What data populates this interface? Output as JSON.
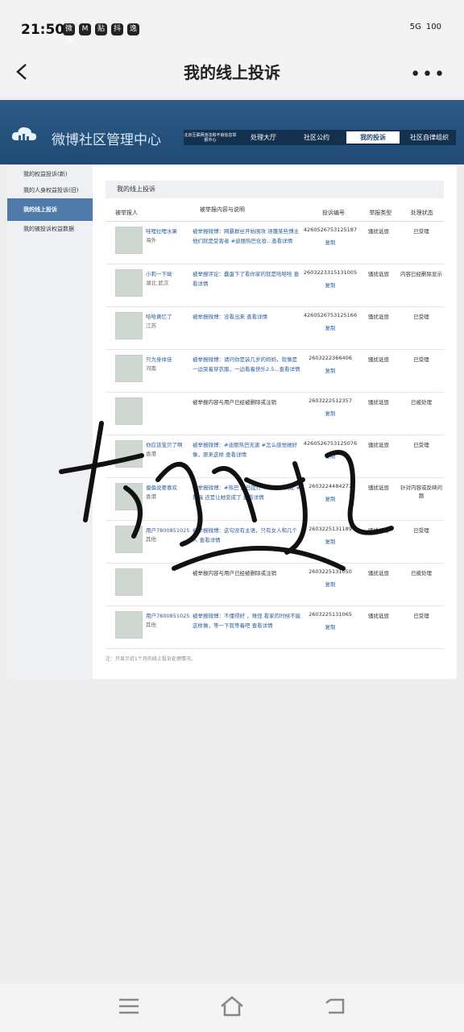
{
  "status_bar": {
    "time": "21:50",
    "apps": [
      "微博",
      "M",
      "贴",
      "抖",
      "逸"
    ],
    "network": "5G",
    "battery": "100"
  },
  "nav": {
    "title": "我的线上投诉"
  },
  "header": {
    "site_name": "微博社区管理中心",
    "nav_items": [
      "北京互联网违法和不良信息举报中心",
      "处理大厅",
      "社区公约",
      "我的投诉",
      "社区自律组织"
    ]
  },
  "sidebar": {
    "items": [
      "我的权益投诉(新)",
      "我的人身权益投诉(旧)",
      "我的线上投诉",
      "我的被投诉权益数据"
    ]
  },
  "content": {
    "title": "我的线上投诉",
    "columns": [
      "被举报人",
      "被举报内容与说明",
      "投诉编号",
      "举报类型",
      "处理状态"
    ],
    "copy_label": "复制",
    "rows": [
      {
        "name": "哇哩拉哩水果",
        "loc": "海外",
        "desc": "被举报微博：网暴群丝开始围攻 诬蔑某些博主他们就是受害者 #迪丽热巴化妆...查看详情",
        "id": "4260526753125187",
        "type": "骚扰诋毁",
        "status": "已受理"
      },
      {
        "name": "小莉一下呦",
        "loc": "湖北 武汉",
        "desc": "被举报评论：蠢蛋下了看你家的就是哈哈哈 查看详情",
        "id": "2603223315131005",
        "type": "骚扰诋毁",
        "status": "内容已经删除显示"
      },
      {
        "name": "哈哈黄忆了",
        "loc": "江苏",
        "desc": "被举报微博：没看出来 查看详情",
        "id": "4260526753125166",
        "type": "骚扰诋毁",
        "status": "已受理"
      },
      {
        "name": "只为身体佳",
        "loc": "河南",
        "desc": "被举报微博：请问你是装几岁的妈妈，就像是一边哭着穿衣服，一边看着快乐2.5...查看详情",
        "id": "2603222366406",
        "type": "骚扰诋毁",
        "status": "已受理"
      },
      {
        "name": "",
        "loc": "",
        "desc": "被举报内容与用户已经被删除或注销",
        "id": "2603222512357",
        "type": "骚扰诋毁",
        "status": "已被处理"
      },
      {
        "name": "你应该宝贝了啊",
        "loc": "香港",
        "desc": "被举报微博：#迪丽热巴无害 #怎么感觉她好像，原来这样 查看详情",
        "id": "4260526753125076",
        "type": "骚扰诋毁",
        "status": "已受理"
      },
      {
        "name": "偏偏说要喜欢",
        "loc": "香港",
        "desc": "被举报微博：#热巴 白日提灯 #现在 #网友 #投稿 还是让她变成了 查看详情",
        "id": "2603224484277",
        "type": "骚扰诋毁",
        "status": "针对内容或反映问题"
      },
      {
        "name": "用户7800851025",
        "loc": "其他",
        "desc": "被举报微博：这句没有主语，只有女人和几个人 查看详情",
        "id": "2603225131189",
        "type": "骚扰诋毁",
        "status": "已受理"
      },
      {
        "name": "",
        "loc": "",
        "desc": "被举报内容与用户已经被删除或注销",
        "id": "2603225131050",
        "type": "骚扰诋毁",
        "status": "已被处理"
      },
      {
        "name": "用户7800851025",
        "loc": "其他",
        "desc": "被举报微博：不懂得好 ，难怪 看家的时候不能这样做，等一下就等着吧 查看详情",
        "id": "2603225131065",
        "type": "骚扰诋毁",
        "status": "已受理"
      }
    ],
    "note": "注：只显示近1个月的线上投诉处理情况。"
  }
}
